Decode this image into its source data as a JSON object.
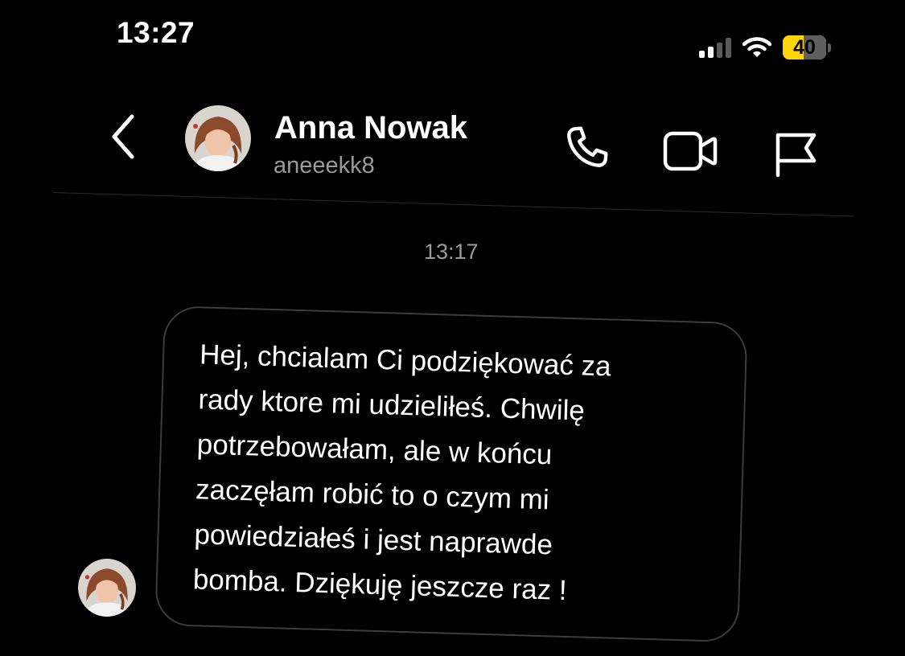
{
  "status_bar": {
    "time": "13:27",
    "battery_level": "40",
    "signal_bars_active": 2,
    "signal_bars_total": 4,
    "battery_color": "#ffd60a"
  },
  "header": {
    "back_icon": "chevron-left-icon",
    "name": "Anna Nowak",
    "handle": "aneeekk8",
    "actions": [
      "phone-icon",
      "video-camera-icon",
      "flag-icon"
    ]
  },
  "conversation": {
    "timestamp": "13:17",
    "messages": [
      {
        "direction": "incoming",
        "text": "Hej, chcialam Ci podziękować za\nrady ktore mi udzieliłeś. Chwilę\npotrzebowałam,  ale w końcu\nzaczęłam robić to o czym mi\npowiedziałeś  i jest naprawde\nbomba. Dziękuję jeszcze raz !"
      }
    ]
  },
  "colors": {
    "background": "#000000",
    "text": "#ffffff",
    "muted_text": "#9a9a9a",
    "bubble_border": "#3c3c3c"
  }
}
